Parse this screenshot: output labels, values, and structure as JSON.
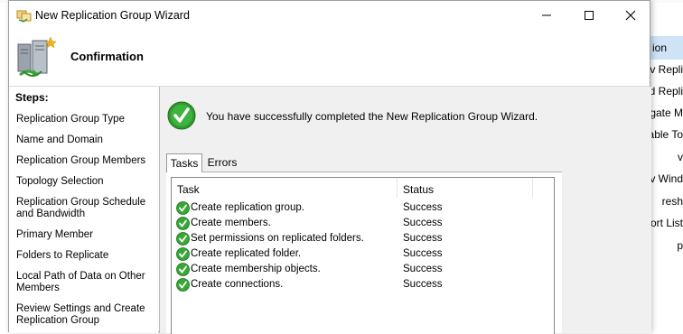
{
  "background_app": {
    "actions_header": "ion",
    "items": [
      "v Repli",
      "d Repli",
      "egate M",
      "able To",
      "v",
      "v Wind",
      "resh",
      "ort List",
      "p"
    ]
  },
  "window": {
    "title": "New Replication Group Wizard",
    "header_title": "Confirmation"
  },
  "steps": {
    "title": "Steps:",
    "items": [
      "Replication Group Type",
      "Name and Domain",
      "Replication Group Members",
      "Topology Selection",
      "Replication Group Schedule and Bandwidth",
      "Primary Member",
      "Folders to Replicate",
      "Local Path of Data on Other Members",
      "Review Settings and Create Replication Group"
    ]
  },
  "content": {
    "success_message": "You have successfully completed the New Replication Group Wizard.",
    "tabs": [
      "Tasks",
      "Errors"
    ],
    "columns": [
      "Task",
      "Status"
    ],
    "rows": [
      {
        "task": "Create replication group.",
        "status": "Success"
      },
      {
        "task": "Create members.",
        "status": "Success"
      },
      {
        "task": "Set permissions on replicated folders.",
        "status": "Success"
      },
      {
        "task": "Create replicated folder.",
        "status": "Success"
      },
      {
        "task": "Create membership objects.",
        "status": "Success"
      },
      {
        "task": "Create connections.",
        "status": "Success"
      }
    ]
  },
  "colors": {
    "success_green": "#2e9b2e",
    "actions_highlight": "#cfe3f6"
  }
}
